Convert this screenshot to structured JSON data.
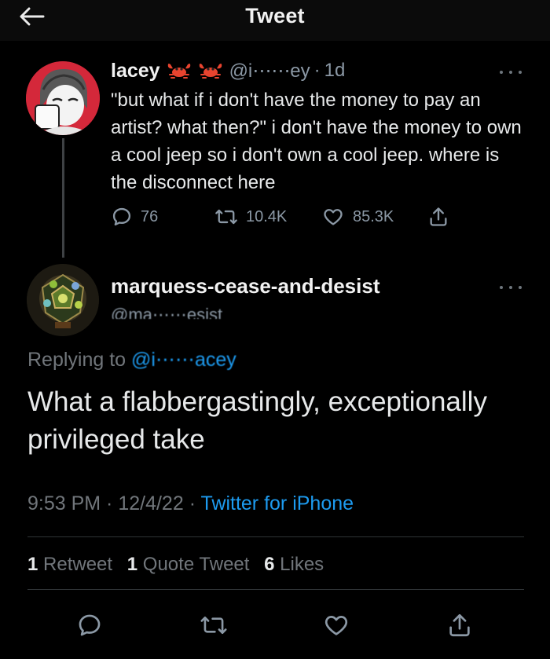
{
  "header": {
    "title": "Tweet"
  },
  "parent_tweet": {
    "author_name": "lacey",
    "handle": "@i⋯⋯ey",
    "age": "1d",
    "text": "\"but what if i don't have the money to pay an artist? what then?\" i don't have the money to own a cool jeep so i don't own a cool jeep. where is the disconnect here",
    "replies": "76",
    "retweets": "10.4K",
    "likes": "85.3K"
  },
  "reply_tweet": {
    "author_name": "marquess-cease-and-desist",
    "handle": "@ma⋯⋯esist",
    "replying_prefix": "Replying to ",
    "replying_mention": "@i⋯⋯acey",
    "text": "What a flabbergastingly, exceptionally privileged take",
    "time": "9:53 PM",
    "date": "12/4/22",
    "source": "Twitter for iPhone",
    "retweets_count": "1",
    "retweets_label": "Retweet",
    "quotes_count": "1",
    "quotes_label": "Quote Tweet",
    "likes_count": "6",
    "likes_label": "Likes"
  },
  "colors": {
    "accent": "#1d9bf0",
    "background": "#000000",
    "secondary_text": "#71767b",
    "crab": "#e8442f"
  }
}
